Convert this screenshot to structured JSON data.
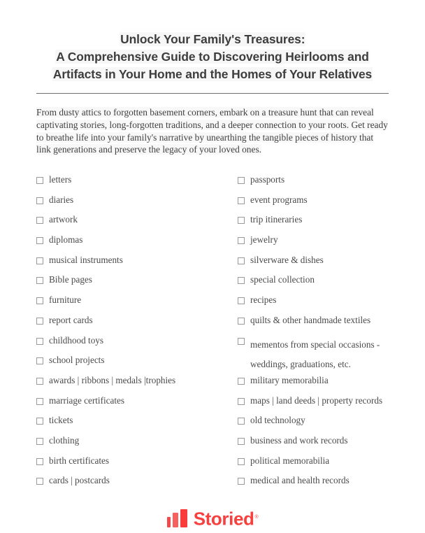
{
  "document": {
    "title_lines": [
      "Unlock Your Family's Treasures:",
      "A Comprehensive Guide to Discovering Heirlooms and",
      "Artifacts in Your Home and the Homes of Your Relatives"
    ],
    "intro_paragraph": "From dusty attics to forgotten basement corners, embark on a treasure hunt that can reveal captivating stories, long-forgotten traditions, and a deeper connection to your roots. Get ready to breathe life into your family's narrative by unearthing the tangible pieces of history that link generations and preserve the legacy of your loved ones."
  },
  "checklist": {
    "left_column": [
      {
        "label": "letters",
        "checked": false
      },
      {
        "label": "diaries",
        "checked": false
      },
      {
        "label": "artwork",
        "checked": false
      },
      {
        "label": "diplomas",
        "checked": false
      },
      {
        "label": "musical instruments",
        "checked": false
      },
      {
        "label": "Bible pages",
        "checked": false
      },
      {
        "label": "furniture",
        "checked": false
      },
      {
        "label": "report cards",
        "checked": false
      },
      {
        "label": "childhood toys",
        "checked": false
      },
      {
        "label": "school projects",
        "checked": false
      },
      {
        "label": "awards | ribbons | medals |trophies",
        "checked": false
      },
      {
        "label": "marriage certificates",
        "checked": false
      },
      {
        "label": "tickets",
        "checked": false
      },
      {
        "label": "clothing",
        "checked": false
      },
      {
        "label": "birth certificates",
        "checked": false
      },
      {
        "label": "cards | postcards",
        "checked": false
      }
    ],
    "right_column": [
      {
        "label": "passports",
        "checked": false
      },
      {
        "label": "event programs",
        "checked": false
      },
      {
        "label": "trip itineraries",
        "checked": false
      },
      {
        "label": "jewelry",
        "checked": false
      },
      {
        "label": "silverware & dishes",
        "checked": false
      },
      {
        "label": "special collection",
        "checked": false
      },
      {
        "label": "recipes",
        "checked": false
      },
      {
        "label": "quilts & other handmade textiles",
        "checked": false
      },
      {
        "label": "mementos from special occasions -\nweddings, graduations, etc.",
        "checked": false,
        "wraps": true
      },
      {
        "label": "military memorabilia",
        "checked": false
      },
      {
        "label": "maps | land deeds | property records",
        "checked": false
      },
      {
        "label": "old technology",
        "checked": false
      },
      {
        "label": "business and work records",
        "checked": false
      },
      {
        "label": "political memorabilia",
        "checked": false
      },
      {
        "label": "medical and health records",
        "checked": false
      }
    ]
  },
  "footer": {
    "brand_name": "Storied",
    "trademark_symbol": "®",
    "brand_color": "#f8403f"
  }
}
